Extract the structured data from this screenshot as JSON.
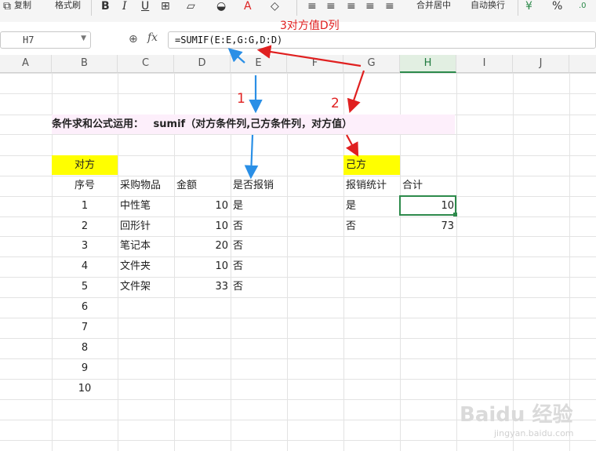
{
  "toolbar": {
    "copy_label": "复制",
    "format_painter_label": "格式刷",
    "bold": "B",
    "italic": "I",
    "underline": "U",
    "merge_center_label": "合并居中",
    "wrap_text_label": "自动换行",
    "percent": "%"
  },
  "formula_bar": {
    "name_box": "H7",
    "fx": "fx",
    "formula": "=SUMIF(E:E,G:G,D:D)"
  },
  "columns": [
    "A",
    "B",
    "C",
    "D",
    "E",
    "F",
    "G",
    "H",
    "I",
    "J"
  ],
  "sheet": {
    "heading": "条件求和公式运用：",
    "heading_formula": "sumif（对方条件列,己方条件列，对方值）",
    "left_label": "对方",
    "right_label": "己方",
    "left_headers": [
      "序号",
      "采购物品",
      "金额",
      "是否报销"
    ],
    "rows": [
      {
        "no": "1",
        "item": "中性笔",
        "amount": "10",
        "reimbursed": "是"
      },
      {
        "no": "2",
        "item": "回形针",
        "amount": "10",
        "reimbursed": "否"
      },
      {
        "no": "3",
        "item": "笔记本",
        "amount": "20",
        "reimbursed": "否"
      },
      {
        "no": "4",
        "item": "文件夹",
        "amount": "10",
        "reimbursed": "否"
      },
      {
        "no": "5",
        "item": "文件架",
        "amount": "33",
        "reimbursed": "否"
      },
      {
        "no": "6"
      },
      {
        "no": "7"
      },
      {
        "no": "8"
      },
      {
        "no": "9"
      },
      {
        "no": "10"
      }
    ],
    "right_headers": [
      "报销统计",
      "合计"
    ],
    "summary": [
      {
        "key": "是",
        "total": "10"
      },
      {
        "key": "否",
        "total": "73"
      }
    ]
  },
  "annotations": {
    "label1": "1",
    "label2": "2",
    "label3": "3对方值D列"
  },
  "watermark": {
    "brand": "Baidu 经验",
    "url": "jingyan.baidu.com"
  }
}
